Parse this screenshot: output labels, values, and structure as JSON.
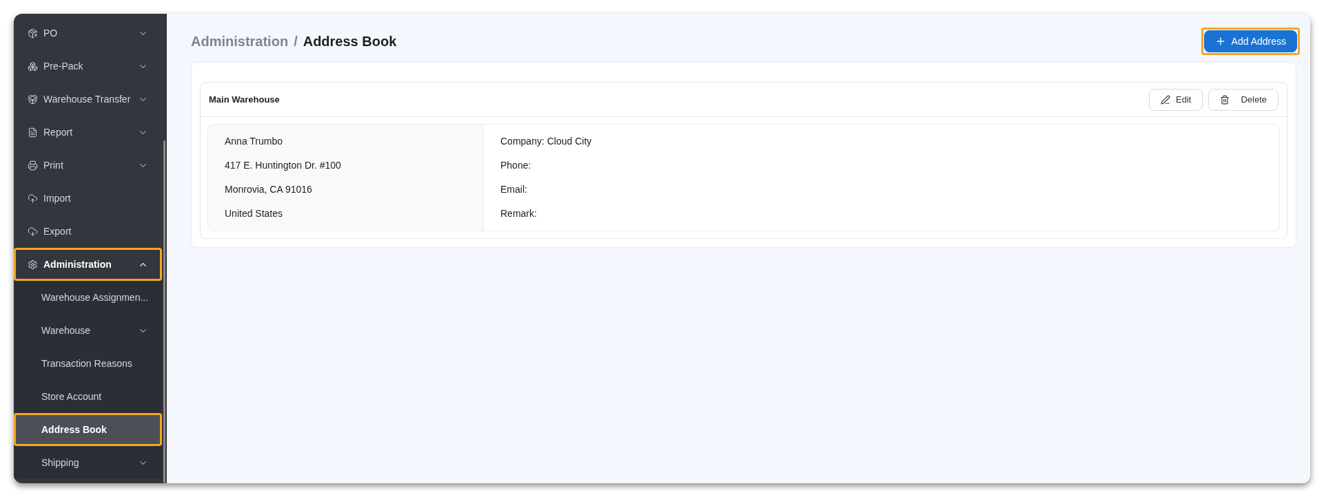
{
  "sidebar": {
    "items": [
      {
        "label": "PO",
        "kind": "group",
        "expanded": false,
        "selected": false,
        "highlighted": false
      },
      {
        "label": "Pre-Pack",
        "kind": "group",
        "expanded": false,
        "selected": false,
        "highlighted": false
      },
      {
        "label": "Warehouse Transfer",
        "kind": "group",
        "expanded": false,
        "selected": false,
        "highlighted": false
      },
      {
        "label": "Report",
        "kind": "group",
        "expanded": false,
        "selected": false,
        "highlighted": false
      },
      {
        "label": "Print",
        "kind": "group",
        "expanded": false,
        "selected": false,
        "highlighted": false
      },
      {
        "label": "Import",
        "kind": "link",
        "selected": false,
        "highlighted": false
      },
      {
        "label": "Export",
        "kind": "link",
        "selected": false,
        "highlighted": false
      },
      {
        "label": "Administration",
        "kind": "group",
        "expanded": true,
        "selected": false,
        "highlighted": true,
        "children": [
          {
            "label": "Warehouse Assignmen...",
            "kind": "link",
            "selected": false,
            "highlighted": false
          },
          {
            "label": "Warehouse",
            "kind": "group",
            "expanded": false,
            "selected": false,
            "highlighted": false
          },
          {
            "label": "Transaction Reasons",
            "kind": "link",
            "selected": false,
            "highlighted": false
          },
          {
            "label": "Store Account",
            "kind": "link",
            "selected": false,
            "highlighted": false
          },
          {
            "label": "Address Book",
            "kind": "link",
            "selected": true,
            "highlighted": true
          },
          {
            "label": "Shipping",
            "kind": "group",
            "expanded": false,
            "selected": false,
            "highlighted": false
          }
        ]
      }
    ]
  },
  "breadcrumb": [
    "Administration",
    "/",
    "Address Book"
  ],
  "add_button": {
    "label": "Add Address",
    "highlighted": true
  },
  "addresses": [
    {
      "title": "Main Warehouse",
      "edit": "Edit",
      "delete": "Delete",
      "left_lines": [
        "Anna Trumbo",
        "417 E. Huntington Dr. #100",
        "Monrovia, CA 91016",
        "United States"
      ],
      "right_lines": [
        "Company: Cloud City",
        "Phone:",
        "Email:",
        "Remark:"
      ]
    }
  ]
}
